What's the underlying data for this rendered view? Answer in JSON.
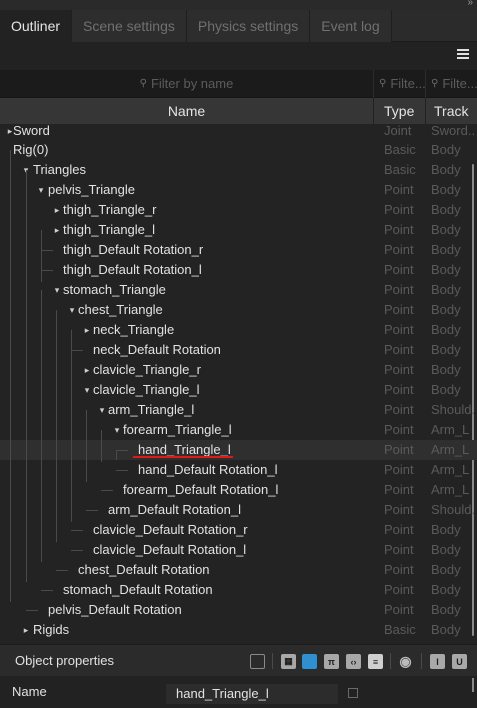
{
  "tabs": [
    "Outliner",
    "Scene settings",
    "Physics settings",
    "Event log"
  ],
  "filters": {
    "name": "Filter by name",
    "type": "Filte...",
    "track": "Filte..."
  },
  "columns": {
    "name": "Name",
    "type": "Type",
    "track": "Track"
  },
  "rows": [
    {
      "label": "Sword",
      "type": "Joint",
      "track": "Sword..."
    },
    {
      "label": "Rig(0)",
      "type": "Basic",
      "track": "Body"
    },
    {
      "label": "Triangles",
      "type": "Basic",
      "track": "Body"
    },
    {
      "label": "pelvis_Triangle",
      "type": "Point",
      "track": "Body"
    },
    {
      "label": "thigh_Triangle_r",
      "type": "Point",
      "track": "Body"
    },
    {
      "label": "thigh_Triangle_l",
      "type": "Point",
      "track": "Body"
    },
    {
      "label": "thigh_Default Rotation_r",
      "type": "Point",
      "track": "Body"
    },
    {
      "label": "thigh_Default Rotation_l",
      "type": "Point",
      "track": "Body"
    },
    {
      "label": "stomach_Triangle",
      "type": "Point",
      "track": "Body"
    },
    {
      "label": "chest_Triangle",
      "type": "Point",
      "track": "Body"
    },
    {
      "label": "neck_Triangle",
      "type": "Point",
      "track": "Body"
    },
    {
      "label": "neck_Default Rotation",
      "type": "Point",
      "track": "Body"
    },
    {
      "label": "clavicle_Triangle_r",
      "type": "Point",
      "track": "Body"
    },
    {
      "label": "clavicle_Triangle_l",
      "type": "Point",
      "track": "Body"
    },
    {
      "label": "arm_Triangle_l",
      "type": "Point",
      "track": "Should..."
    },
    {
      "label": "forearm_Triangle_l",
      "type": "Point",
      "track": "Arm_L"
    },
    {
      "label": "hand_Triangle_l",
      "type": "Point",
      "track": "Arm_L"
    },
    {
      "label": "hand_Default Rotation_l",
      "type": "Point",
      "track": "Arm_L"
    },
    {
      "label": "forearm_Default Rotation_l",
      "type": "Point",
      "track": "Arm_L"
    },
    {
      "label": "arm_Default Rotation_l",
      "type": "Point",
      "track": "Should..."
    },
    {
      "label": "clavicle_Default Rotation_r",
      "type": "Point",
      "track": "Body"
    },
    {
      "label": "clavicle_Default Rotation_l",
      "type": "Point",
      "track": "Body"
    },
    {
      "label": "chest_Default Rotation",
      "type": "Point",
      "track": "Body"
    },
    {
      "label": "stomach_Default Rotation",
      "type": "Point",
      "track": "Body"
    },
    {
      "label": "pelvis_Default Rotation",
      "type": "Point",
      "track": "Body"
    },
    {
      "label": "Rigids",
      "type": "Basic",
      "track": "Body"
    }
  ],
  "properties": {
    "title": "Object properties",
    "name_label": "Name",
    "name_value": "hand_Triangle_l"
  },
  "colors": {
    "background": "#232323",
    "header": "#363636",
    "highlight": "#e01818",
    "accent": "#2f8fd0"
  }
}
